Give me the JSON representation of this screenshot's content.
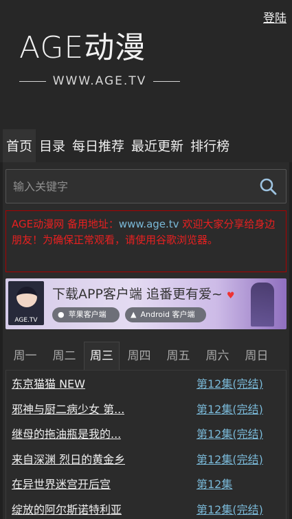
{
  "header": {
    "login_label": "登陆",
    "logo_main": "AGE动漫",
    "logo_sub": "WWW.AGE.TV"
  },
  "nav": {
    "items": [
      {
        "label": "首页",
        "active": true
      },
      {
        "label": "目录"
      },
      {
        "label": "每日推荐"
      },
      {
        "label": "最近更新"
      },
      {
        "label": "排行榜"
      }
    ]
  },
  "search": {
    "placeholder": "输入关键字",
    "icon": "search-icon"
  },
  "notice": {
    "prefix": "AGE动漫网 备用地址：",
    "url": "www.age.tv",
    "suffix": " 欢迎大家分享给身边朋友！为确保正常观看，请使用谷歌浏览器。"
  },
  "banner": {
    "icon_tag": "AGE.TV",
    "title": "下载APP客户端 追番更有爱~",
    "ios_label": "苹果客户端",
    "android_label": "Android 客户端"
  },
  "week_tabs": [
    "周一",
    "周二",
    "周三",
    "周四",
    "周五",
    "周六",
    "周日"
  ],
  "active_week": "周三",
  "schedule": [
    {
      "title": "东京猫猫 NEW",
      "episode": "第12集(完结)"
    },
    {
      "title": "邪神与厨二病少女 第...",
      "episode": "第12集(完结)"
    },
    {
      "title": "继母的拖油瓶是我的...",
      "episode": "第12集(完结)"
    },
    {
      "title": "来自深渊 烈日的黄金乡",
      "episode": "第12集(完结)"
    },
    {
      "title": "在异世界迷宫开后宫",
      "episode": "第12集"
    },
    {
      "title": "绽放的阿尔斯诺特利亚",
      "episode": "第12集(完结)"
    }
  ]
}
